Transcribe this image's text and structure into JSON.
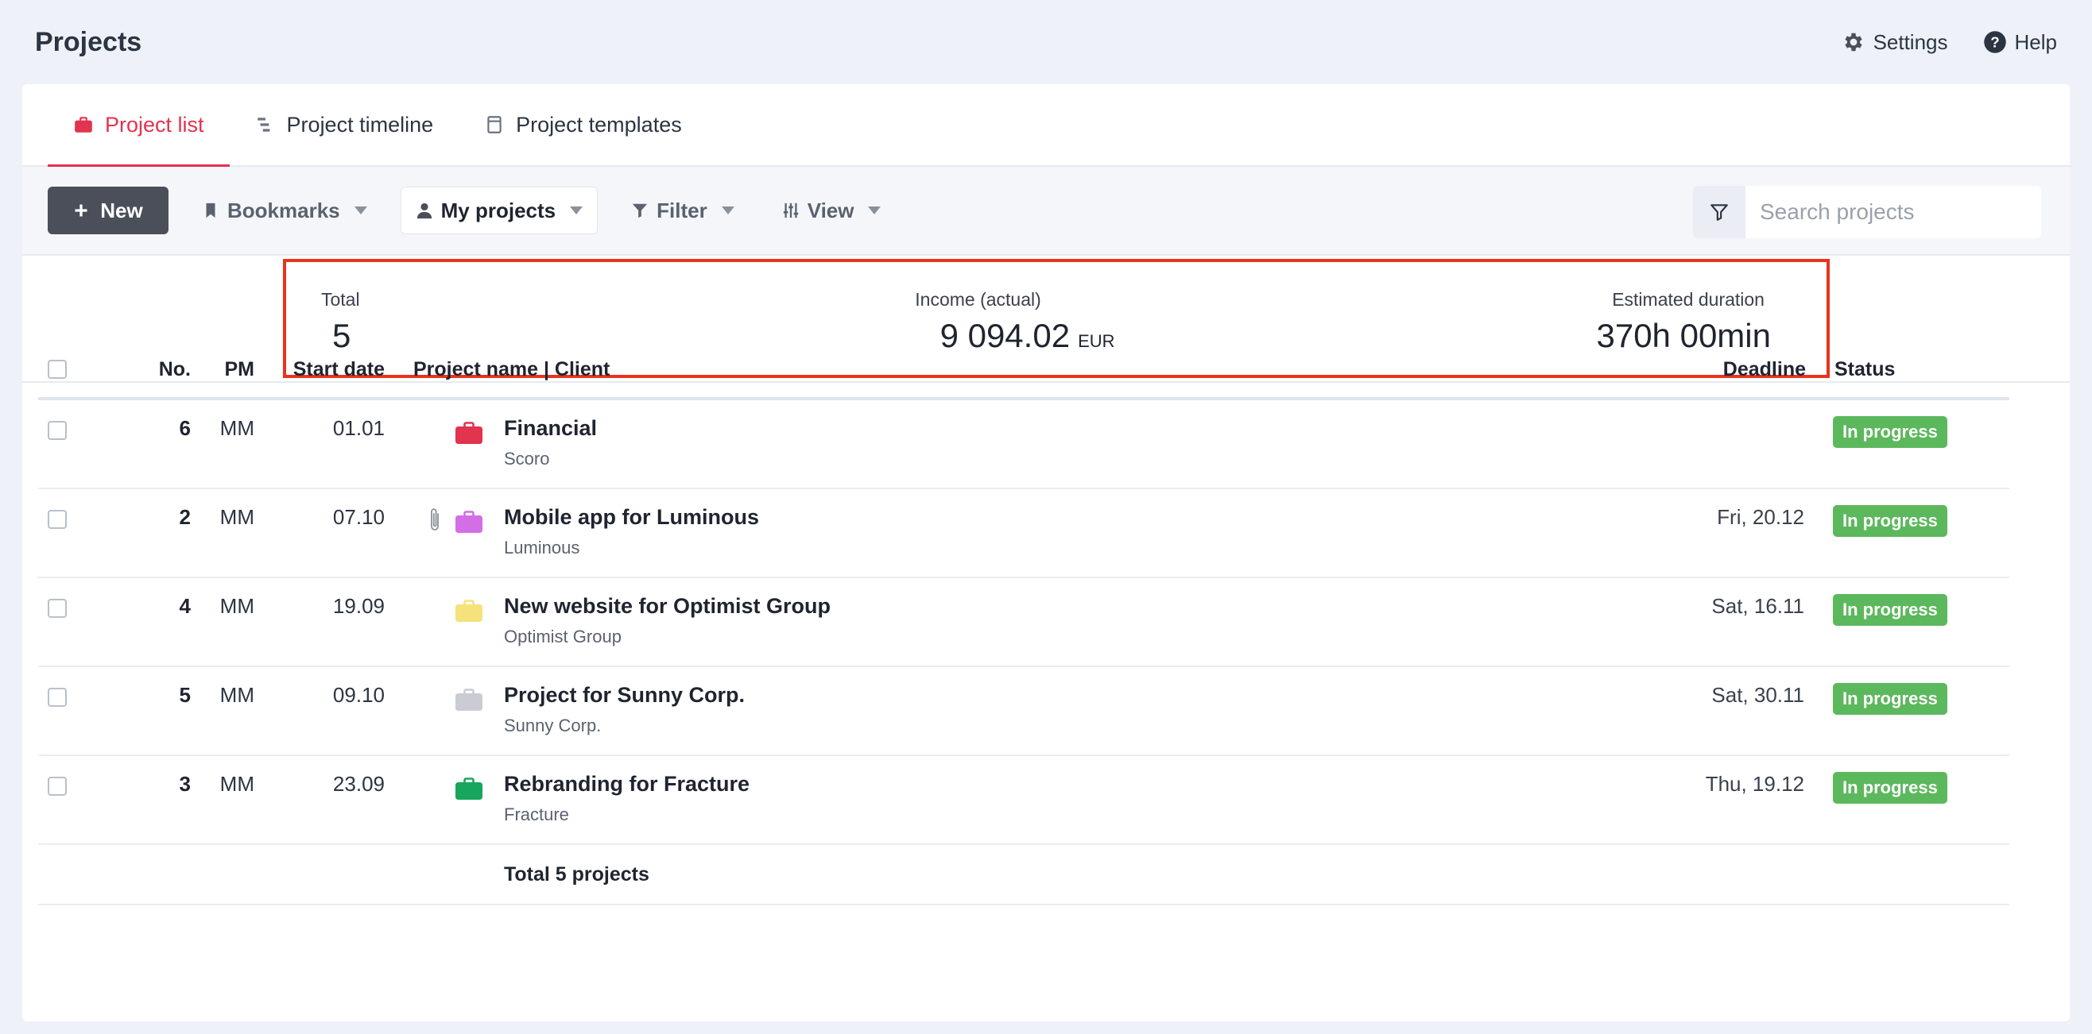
{
  "header": {
    "title": "Projects",
    "settings_label": "Settings",
    "help_label": "Help"
  },
  "tabs": [
    {
      "label": "Project list",
      "icon": "briefcase-icon",
      "active": true
    },
    {
      "label": "Project timeline",
      "icon": "timeline-icon",
      "active": false
    },
    {
      "label": "Project templates",
      "icon": "template-icon",
      "active": false
    }
  ],
  "toolbar": {
    "new_label": "New",
    "bookmarks_label": "Bookmarks",
    "my_projects_label": "My projects",
    "filter_label": "Filter",
    "view_label": "View",
    "search_placeholder": "Search projects"
  },
  "summary": {
    "total_label": "Total",
    "total_value": "5",
    "income_label": "Income (actual)",
    "income_value": "9 094.02",
    "income_currency": "EUR",
    "duration_label": "Estimated duration",
    "duration_value": "370h 00min"
  },
  "table": {
    "columns": {
      "no": "No.",
      "pm": "PM",
      "start": "Start date",
      "name": "Project name | Client",
      "deadline": "Deadline",
      "status": "Status"
    },
    "rows": [
      {
        "no": "6",
        "pm": "MM",
        "start": "01.01",
        "name": "Financial",
        "client": "Scoro",
        "deadline": "",
        "status": "In progress",
        "color": "#e2334f",
        "attachment": false
      },
      {
        "no": "2",
        "pm": "MM",
        "start": "07.10",
        "name": "Mobile app for Luminous",
        "client": "Luminous",
        "deadline": "Fri, 20.12",
        "status": "In progress",
        "color": "#d46ee6",
        "attachment": true
      },
      {
        "no": "4",
        "pm": "MM",
        "start": "19.09",
        "name": "New website for Optimist Group",
        "client": "Optimist Group",
        "deadline": "Sat, 16.11",
        "status": "In progress",
        "color": "#f6e27a",
        "attachment": false
      },
      {
        "no": "5",
        "pm": "MM",
        "start": "09.10",
        "name": "Project for Sunny Corp.",
        "client": "Sunny Corp.",
        "deadline": "Sat, 30.11",
        "status": "In progress",
        "color": "#c9cdd3",
        "attachment": false
      },
      {
        "no": "3",
        "pm": "MM",
        "start": "23.09",
        "name": "Rebranding for Fracture",
        "client": "Fracture",
        "deadline": "Thu, 19.12",
        "status": "In progress",
        "color": "#17a65b",
        "attachment": false
      }
    ],
    "total_label": "Total 5 projects"
  },
  "colors": {
    "accent": "#e2334f",
    "status_green": "#5cb85c",
    "highlight_border": "#e8341c"
  }
}
